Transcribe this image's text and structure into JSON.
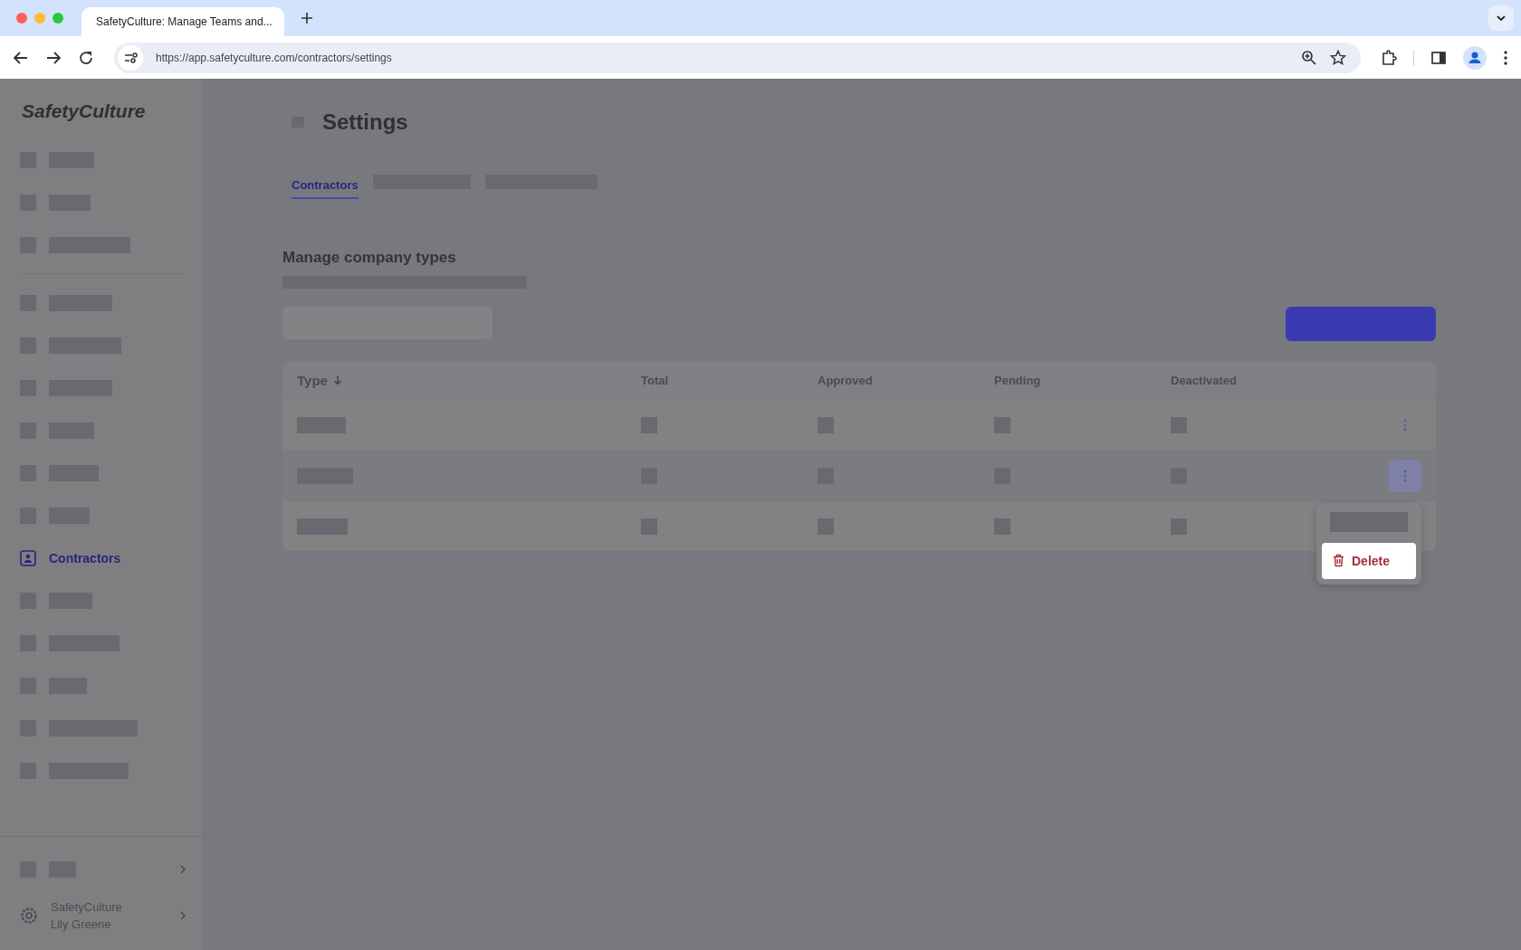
{
  "browser": {
    "tab_title": "SafetyCulture: Manage Teams and...",
    "url": "https://app.safetyculture.com/contractors/settings"
  },
  "sidebar": {
    "logo": "SafetyCulture",
    "items": [
      {
        "kind": "redacted"
      },
      {
        "kind": "redacted"
      },
      {
        "kind": "redacted"
      },
      {
        "kind": "divider"
      },
      {
        "kind": "redacted"
      },
      {
        "kind": "redacted"
      },
      {
        "kind": "redacted"
      },
      {
        "kind": "redacted"
      },
      {
        "kind": "redacted"
      },
      {
        "kind": "redacted"
      },
      {
        "kind": "link",
        "label": "Contractors",
        "selected": true
      },
      {
        "kind": "redacted"
      },
      {
        "kind": "redacted"
      },
      {
        "kind": "redacted"
      },
      {
        "kind": "redacted"
      },
      {
        "kind": "redacted"
      }
    ],
    "footer": {
      "organization": "SafetyCulture",
      "user": "Lily Greene"
    }
  },
  "page": {
    "title": "Settings",
    "tabs": [
      {
        "kind": "link",
        "label": "Contractors",
        "selected": true
      },
      {
        "kind": "redacted",
        "selected": false
      },
      {
        "kind": "redacted",
        "selected": false
      }
    ],
    "section_title": "Manage company types",
    "table": {
      "columns": [
        "Type",
        "Total",
        "Approved",
        "Pending",
        "Deactivated"
      ],
      "rows": [
        {
          "menu_open": false
        },
        {
          "menu_open": true
        },
        {
          "menu_open": false
        }
      ]
    },
    "menu": {
      "items": [
        {
          "kind": "redacted"
        },
        {
          "kind": "action",
          "label": "Delete"
        }
      ]
    }
  }
}
